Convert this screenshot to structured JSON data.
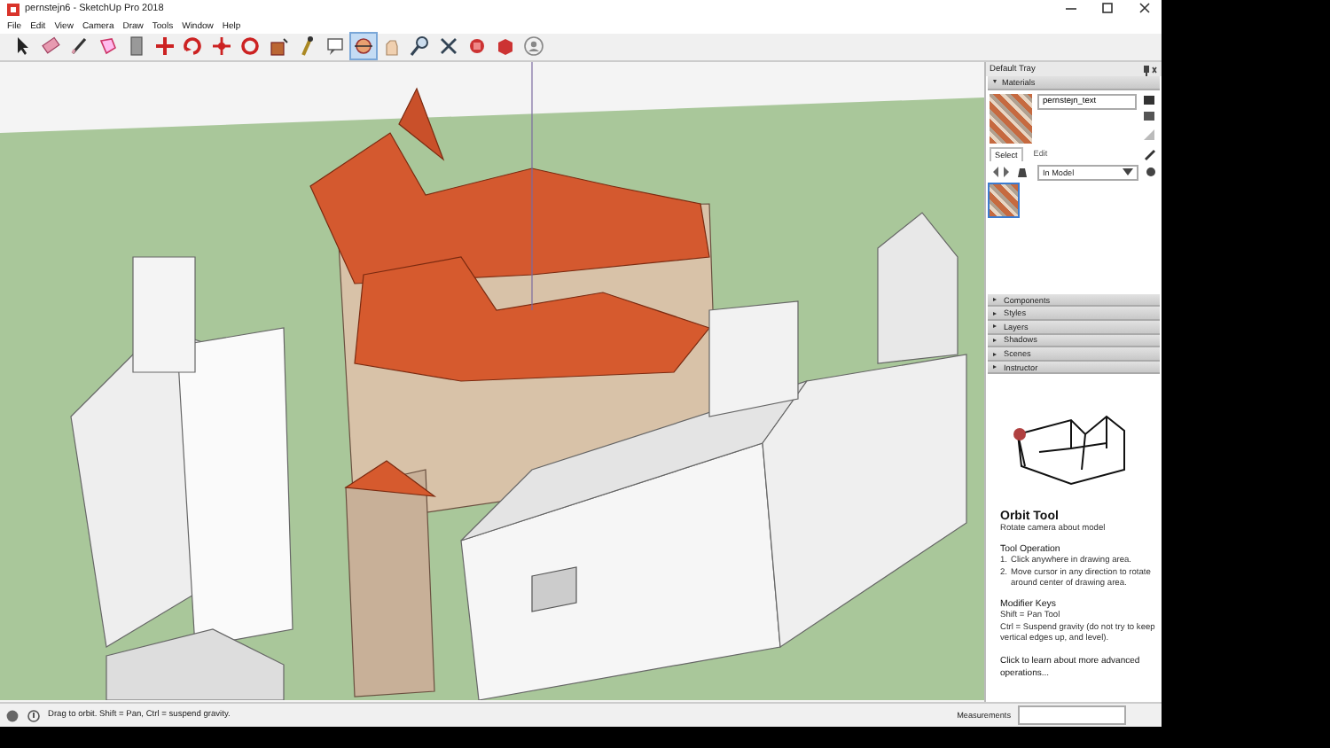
{
  "window": {
    "title": "pernstejn6 - SketchUp Pro 2018"
  },
  "menu": [
    "File",
    "Edit",
    "View",
    "Camera",
    "Draw",
    "Tools",
    "Window",
    "Help"
  ],
  "toolbar": [
    {
      "kind": "select",
      "selected": false
    },
    {
      "kind": "eraser",
      "selected": false
    },
    {
      "kind": "line",
      "selected": false
    },
    {
      "kind": "shape",
      "selected": false
    },
    {
      "kind": "pushpull",
      "selected": false
    },
    {
      "kind": "move",
      "selected": false
    },
    {
      "kind": "rotate",
      "selected": false
    },
    {
      "kind": "scale",
      "selected": false
    },
    {
      "kind": "offset",
      "selected": false
    },
    {
      "kind": "paint",
      "selected": false
    },
    {
      "kind": "tape",
      "selected": false
    },
    {
      "kind": "text",
      "selected": false
    },
    {
      "kind": "orbit",
      "selected": true
    },
    {
      "kind": "pan",
      "selected": false
    },
    {
      "kind": "zoom",
      "selected": false
    },
    {
      "kind": "extents",
      "selected": false
    },
    {
      "kind": "warehouse",
      "selected": false
    },
    {
      "kind": "extension",
      "selected": false
    },
    {
      "kind": "account",
      "selected": false
    }
  ],
  "tray": {
    "title": "Default Tray",
    "materials": {
      "title": "Materials",
      "expanded": true,
      "name_value": "pernstejn_text",
      "tabs": [
        {
          "label": "Select",
          "selected": true
        },
        {
          "label": "Edit",
          "selected": false
        }
      ],
      "library": "In Model",
      "swatches": [
        {
          "selected": true
        }
      ]
    },
    "sections": [
      {
        "label": "Components",
        "expanded": false
      },
      {
        "label": "Styles",
        "expanded": false
      },
      {
        "label": "Layers",
        "expanded": false
      },
      {
        "label": "Shadows",
        "expanded": false
      },
      {
        "label": "Scenes",
        "expanded": false
      },
      {
        "label": "Instructor",
        "expanded": false
      }
    ],
    "instructor": {
      "title": "Orbit Tool",
      "subtitle": "Rotate camera about model",
      "operation_heading": "Tool Operation",
      "steps": [
        {
          "number": "1.",
          "text": "Click anywhere in drawing area."
        },
        {
          "number": "2.",
          "text": "Move cursor in any direction to rotate around center of drawing area."
        }
      ],
      "modifier_heading": "Modifier Keys",
      "modifiers": [
        "Shift = Pan Tool",
        "Ctrl = Suspend gravity (do not try to keep vertical edges up, and level)."
      ],
      "link": "Click to learn about more advanced operations..."
    }
  },
  "status_bar": {
    "hint": "Drag to orbit. Shift = Pan, Ctrl = suspend gravity.",
    "measurements_label": "Measurements"
  }
}
